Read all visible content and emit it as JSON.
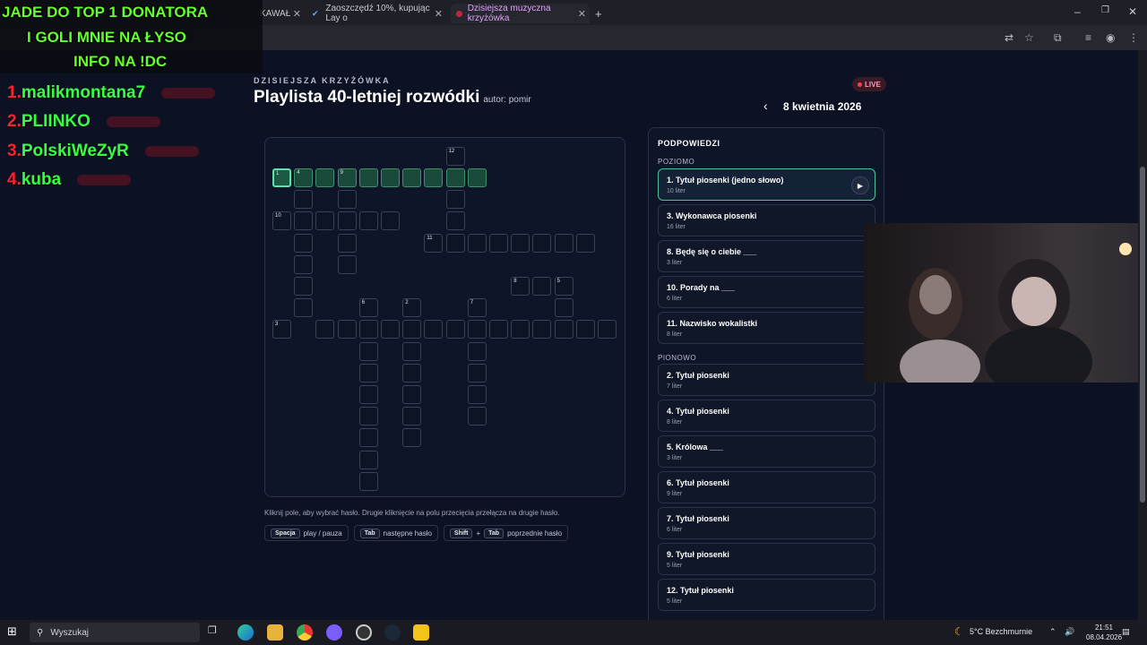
{
  "browser": {
    "tabs": [
      {
        "label": "KAWAŁ",
        "active": false
      },
      {
        "label": "Zaoszczędź 10%, kupując Lay o",
        "active": false
      },
      {
        "label": "Dzisiejsza muzyczna krzyżówka",
        "active": true
      }
    ],
    "new_tab": "+",
    "win": {
      "min": "–",
      "max": "❐",
      "close": "✕"
    }
  },
  "overlay": {
    "line1": "JADE DO TOP 1 DONATORA",
    "line2": "I GOLI MNIE NA ŁYSO",
    "line3": "INFO NA !DC",
    "ranks": [
      {
        "n": "1.",
        "name": "malikmontana7"
      },
      {
        "n": "2.",
        "name": "PLIINKO"
      },
      {
        "n": "3.",
        "name": "PolskiWeZyR"
      },
      {
        "n": "4.",
        "name": "kuba"
      }
    ]
  },
  "header": {
    "kicker": "DZISIEJSZA KRZYŻÓWKA",
    "title": "Playlista 40-letniej rozwódki",
    "author": "autor: pomir",
    "live": "LIVE",
    "prev": "‹",
    "date": "8 kwietnia 2026"
  },
  "footer": {
    "hint": "Kliknij pole, aby wybrać hasło. Drugie kliknięcie na polu przecięcia przełącza na drugie hasło.",
    "k1": "Spacja",
    "k1_desc": "play / pauza",
    "k2": "Tab",
    "k2_desc": "następne hasło",
    "k3a": "Shift",
    "k3_plus": "+",
    "k3b": "Tab",
    "k3_desc": "poprzednie hasło"
  },
  "clues": {
    "heading": "PODPOWIEDZI",
    "across_label": "POZIOMO",
    "down_label": "PIONOWO",
    "play_icon": "▶",
    "across": [
      {
        "title": "1. Tytuł piosenki (jedno słowo)",
        "sub": "10 liter",
        "active": true
      },
      {
        "title": "3. Wykonawca piosenki",
        "sub": "16 liter"
      },
      {
        "title": "8. Będę się o ciebie ___",
        "sub": "3 liter"
      },
      {
        "title": "10. Porady na ___",
        "sub": "6 liter"
      },
      {
        "title": "11. Nazwisko wokalistki",
        "sub": "8 liter"
      }
    ],
    "down": [
      {
        "title": "2. Tytuł piosenki",
        "sub": "7 liter"
      },
      {
        "title": "4. Tytuł piosenki",
        "sub": "8 liter"
      },
      {
        "title": "5. Królowa ___",
        "sub": "3 liter"
      },
      {
        "title": "6. Tytuł piosenki",
        "sub": "9 liter"
      },
      {
        "title": "7. Tytuł piosenki",
        "sub": "6 liter"
      },
      {
        "title": "9. Tytuł piosenki",
        "sub": "5 liter"
      },
      {
        "title": "12. Tytuł piosenki",
        "sub": "5 liter"
      }
    ]
  },
  "crossword": {
    "numbers": {
      "1": "1",
      "2": "2",
      "3": "3",
      "4": "4",
      "5": "5",
      "6": "6",
      "7": "7",
      "8": "8",
      "9": "9",
      "10": "10",
      "11": "11",
      "12": "12"
    }
  },
  "taskbar": {
    "search": "Wyszukaj",
    "weather": "5°C  Bezchmurnie",
    "time": "21:51",
    "date": "08.04.2026"
  }
}
